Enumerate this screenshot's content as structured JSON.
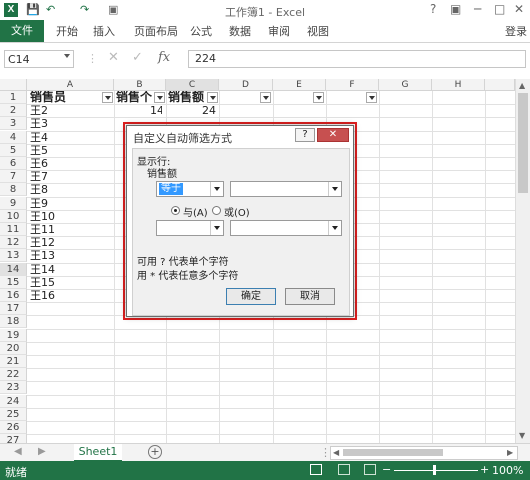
{
  "window": {
    "app_icon": "X",
    "title": "工作簿1 - Excel",
    "controls": [
      "?",
      "▣",
      "─",
      "□",
      "✕"
    ]
  },
  "ribbon": {
    "file_tab": "文件",
    "tabs": [
      "开始",
      "插入",
      "页面布局",
      "公式",
      "数据",
      "审阅",
      "视图"
    ],
    "login": "登录"
  },
  "formula_bar": {
    "name_box": "C14",
    "fx": "fx",
    "value": "224"
  },
  "sheet": {
    "columns": [
      "A",
      "B",
      "C",
      "D",
      "E",
      "F",
      "G",
      "H"
    ],
    "rows": [
      "1",
      "2",
      "3",
      "4",
      "5",
      "6",
      "7",
      "8",
      "9",
      "10",
      "11",
      "12",
      "13",
      "14",
      "15",
      "16",
      "17",
      "18",
      "19",
      "20",
      "21",
      "22",
      "23",
      "24",
      "25",
      "26",
      "27"
    ],
    "headers": [
      "销售员",
      "销售个",
      "销售额"
    ],
    "names": [
      "王2",
      "王3",
      "王4",
      "王5",
      "王6",
      "王7",
      "王8",
      "王9",
      "王10",
      "王11",
      "王12",
      "王13",
      "王14",
      "王15",
      "王16"
    ],
    "b2": "14",
    "c2": "24"
  },
  "sheet_tabs": {
    "active": "Sheet1",
    "add": "+"
  },
  "status": {
    "ready": "就绪",
    "zoom": "100%"
  },
  "dialog": {
    "title": "自定义自动筛选方式",
    "help": "?",
    "close": "✕",
    "show_rows": "显示行:",
    "field": "销售额",
    "op1": "等于",
    "val1": "",
    "and_label": "与(A)",
    "or_label": "或(O)",
    "op2": "",
    "val2": "",
    "hint1": "可用 ? 代表单个字符",
    "hint2": "用 * 代表任意多个字符",
    "ok": "确定",
    "cancel": "取消"
  },
  "colors": {
    "excel_green": "#217346",
    "highlight_red": "#e02020"
  }
}
